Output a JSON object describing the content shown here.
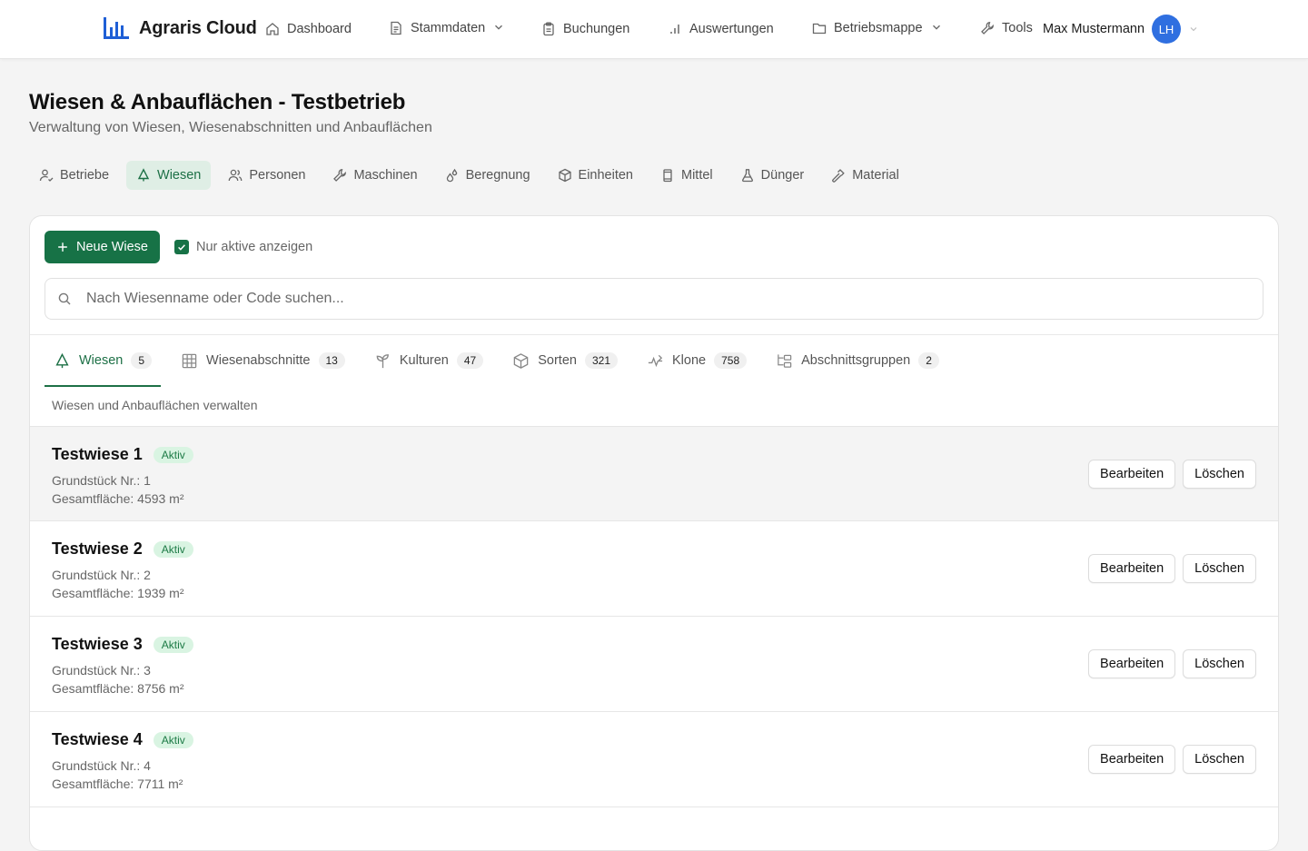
{
  "header": {
    "brand": "Agraris Cloud",
    "nav": [
      {
        "label": "Dashboard"
      },
      {
        "label": "Stammdaten"
      },
      {
        "label": "Buchungen"
      },
      {
        "label": "Auswertungen"
      },
      {
        "label": "Betriebsmappe"
      },
      {
        "label": "Tools"
      }
    ],
    "user": {
      "name": "Max Mustermann",
      "initials": "LH"
    }
  },
  "page": {
    "title": "Wiesen & Anbauflächen - Testbetrieb",
    "subtitle": "Verwaltung von Wiesen, Wiesenabschnitten und Anbauflächen"
  },
  "section_tabs": [
    {
      "label": "Betriebe",
      "active": false
    },
    {
      "label": "Wiesen",
      "active": true
    },
    {
      "label": "Personen",
      "active": false
    },
    {
      "label": "Maschinen",
      "active": false
    },
    {
      "label": "Beregnung",
      "active": false
    },
    {
      "label": "Einheiten",
      "active": false
    },
    {
      "label": "Mittel",
      "active": false
    },
    {
      "label": "Dünger",
      "active": false
    },
    {
      "label": "Material",
      "active": false
    }
  ],
  "toolbar": {
    "new_button": "Neue Wiese",
    "only_active_label": "Nur aktive anzeigen",
    "only_active_checked": true,
    "search_placeholder": "Nach Wiesenname oder Code suchen..."
  },
  "sub_tabs": [
    {
      "label": "Wiesen",
      "count": "5",
      "active": true
    },
    {
      "label": "Wiesenabschnitte",
      "count": "13",
      "active": false
    },
    {
      "label": "Kulturen",
      "count": "47",
      "active": false
    },
    {
      "label": "Sorten",
      "count": "321",
      "active": false
    },
    {
      "label": "Klone",
      "count": "758",
      "active": false
    },
    {
      "label": "Abschnittsgruppen",
      "count": "2",
      "active": false
    }
  ],
  "tab_description": "Wiesen und Anbauflächen verwalten",
  "meadows": [
    {
      "name": "Testwiese 1",
      "status": "Aktiv",
      "parcel": "Grundstück Nr.: 1",
      "area": "Gesamtfläche: 4593 m²"
    },
    {
      "name": "Testwiese 2",
      "status": "Aktiv",
      "parcel": "Grundstück Nr.: 2",
      "area": "Gesamtfläche: 1939 m²"
    },
    {
      "name": "Testwiese 3",
      "status": "Aktiv",
      "parcel": "Grundstück Nr.: 3",
      "area": "Gesamtfläche: 8756 m²"
    },
    {
      "name": "Testwiese 4",
      "status": "Aktiv",
      "parcel": "Grundstück Nr.: 4",
      "area": "Gesamtfläche: 7711 m²"
    }
  ],
  "row_actions": {
    "edit": "Bearbeiten",
    "delete": "Löschen"
  },
  "colors": {
    "brand_green": "#177246",
    "accent_blue": "#2f6fe0",
    "badge_bg": "#d9f4e2"
  }
}
